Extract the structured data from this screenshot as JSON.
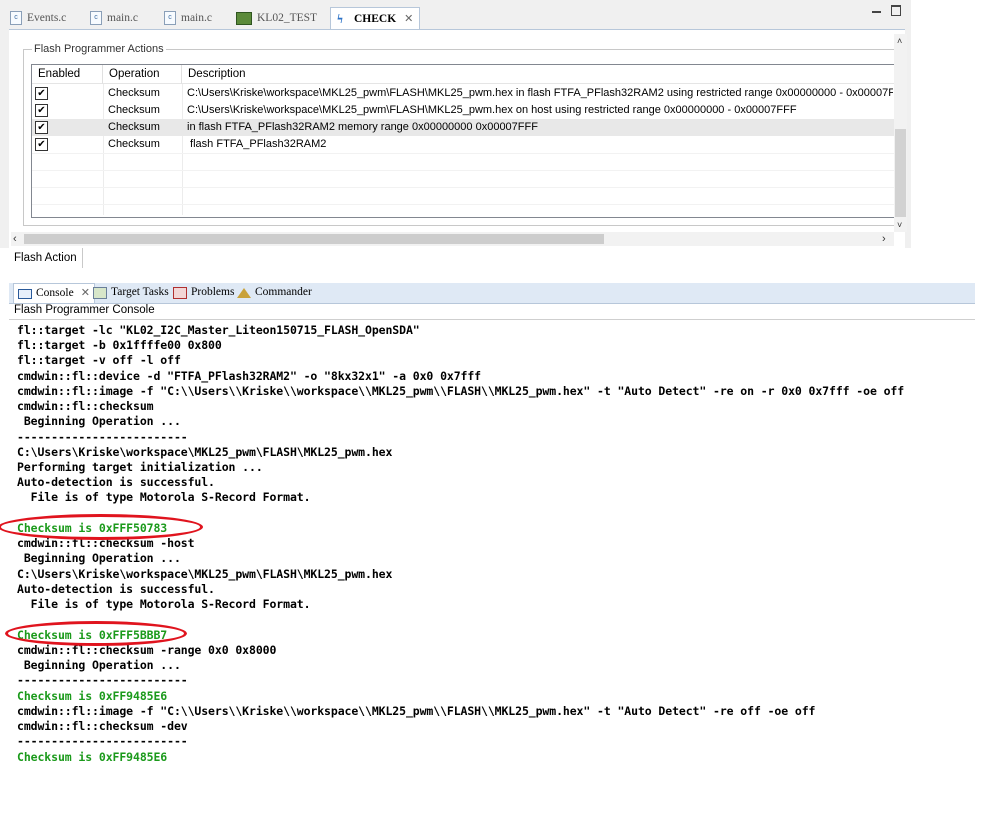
{
  "editor": {
    "tabs": [
      {
        "label": "Events.c",
        "icon": "c-file-icon",
        "active": false
      },
      {
        "label": "main.c",
        "icon": "c-file-icon",
        "active": false
      },
      {
        "label": "main.c",
        "icon": "c-file-icon",
        "active": false
      },
      {
        "label": "KL02_TEST",
        "icon": "project-icon",
        "active": false
      },
      {
        "label": "CHECK",
        "icon": "flash-config-icon",
        "active": true
      }
    ],
    "group_title": "Flash Programmer Actions",
    "table": {
      "columns": [
        "Enabled",
        "Operation",
        "Description"
      ],
      "rows": [
        {
          "enabled": true,
          "operation": "Checksum",
          "description": "C:\\Users\\Kriske\\workspace\\MKL25_pwm\\FLASH\\MKL25_pwm.hex in flash FTFA_PFlash32RAM2 using restricted range 0x00000000 - 0x00007F"
        },
        {
          "enabled": true,
          "operation": "Checksum",
          "description": "C:\\Users\\Kriske\\workspace\\MKL25_pwm\\FLASH\\MKL25_pwm.hex on host using restricted range 0x00000000 - 0x00007FFF"
        },
        {
          "enabled": true,
          "operation": "Checksum",
          "description": "in flash FTFA_PFlash32RAM2  memory range 0x00000000 0x00007FFF"
        },
        {
          "enabled": true,
          "operation": "Checksum",
          "description": " flash FTFA_PFlash32RAM2"
        }
      ],
      "check_mark": "✔"
    },
    "bottom_tab": "Flash Action"
  },
  "console_view": {
    "tabs": [
      {
        "label": "Console",
        "icon": "console-icon",
        "active": true
      },
      {
        "label": "Target Tasks",
        "icon": "target-tasks-icon",
        "active": false
      },
      {
        "label": "Problems",
        "icon": "problems-icon",
        "active": false
      },
      {
        "label": "Commander",
        "icon": "commander-icon",
        "active": false
      }
    ],
    "title": "Flash Programmer Console",
    "highlight_color": "#e0141e",
    "success_color": "#1b9a1b",
    "lines": [
      {
        "text": "fl::target -lc \"KL02_I2C_Master_Liteon150715_FLASH_OpenSDA\"",
        "green": false
      },
      {
        "text": "fl::target -b 0x1ffffe00 0x800",
        "green": false
      },
      {
        "text": "fl::target -v off -l off",
        "green": false
      },
      {
        "text": "cmdwin::fl::device -d \"FTFA_PFlash32RAM2\" -o \"8kx32x1\" -a 0x0 0x7fff",
        "green": false
      },
      {
        "text": "cmdwin::fl::image -f \"C:\\\\Users\\\\Kriske\\\\workspace\\\\MKL25_pwm\\\\FLASH\\\\MKL25_pwm.hex\" -t \"Auto Detect\" -re on -r 0x0 0x7fff -oe off",
        "green": false
      },
      {
        "text": "cmdwin::fl::checksum",
        "green": false
      },
      {
        "text": " Beginning Operation ...",
        "green": false
      },
      {
        "text": "-------------------------",
        "green": false
      },
      {
        "text": "C:\\Users\\Kriske\\workspace\\MKL25_pwm\\FLASH\\MKL25_pwm.hex",
        "green": false
      },
      {
        "text": "Performing target initialization ...",
        "green": false
      },
      {
        "text": "Auto-detection is successful.",
        "green": false
      },
      {
        "text": "  File is of type Motorola S-Record Format.",
        "green": false
      },
      {
        "text": "",
        "green": false
      },
      {
        "text": "Checksum is 0xFFF50783",
        "green": true
      },
      {
        "text": "cmdwin::fl::checksum -host",
        "green": false
      },
      {
        "text": " Beginning Operation ...",
        "green": false
      },
      {
        "text": "C:\\Users\\Kriske\\workspace\\MKL25_pwm\\FLASH\\MKL25_pwm.hex",
        "green": false
      },
      {
        "text": "Auto-detection is successful.",
        "green": false
      },
      {
        "text": "  File is of type Motorola S-Record Format.",
        "green": false
      },
      {
        "text": "",
        "green": false
      },
      {
        "text": "Checksum is 0xFFF5BBB7",
        "green": true
      },
      {
        "text": "cmdwin::fl::checksum -range 0x0 0x8000",
        "green": false
      },
      {
        "text": " Beginning Operation ...",
        "green": false
      },
      {
        "text": "-------------------------",
        "green": false
      },
      {
        "text": "Checksum is 0xFF9485E6",
        "green": true
      },
      {
        "text": "cmdwin::fl::image -f \"C:\\\\Users\\\\Kriske\\\\workspace\\\\MKL25_pwm\\\\FLASH\\\\MKL25_pwm.hex\" -t \"Auto Detect\" -re off -oe off",
        "green": false
      },
      {
        "text": "cmdwin::fl::checksum -dev",
        "green": false
      },
      {
        "text": "-------------------------",
        "green": false
      },
      {
        "text": "Checksum is 0xFF9485E6",
        "green": true
      }
    ]
  }
}
